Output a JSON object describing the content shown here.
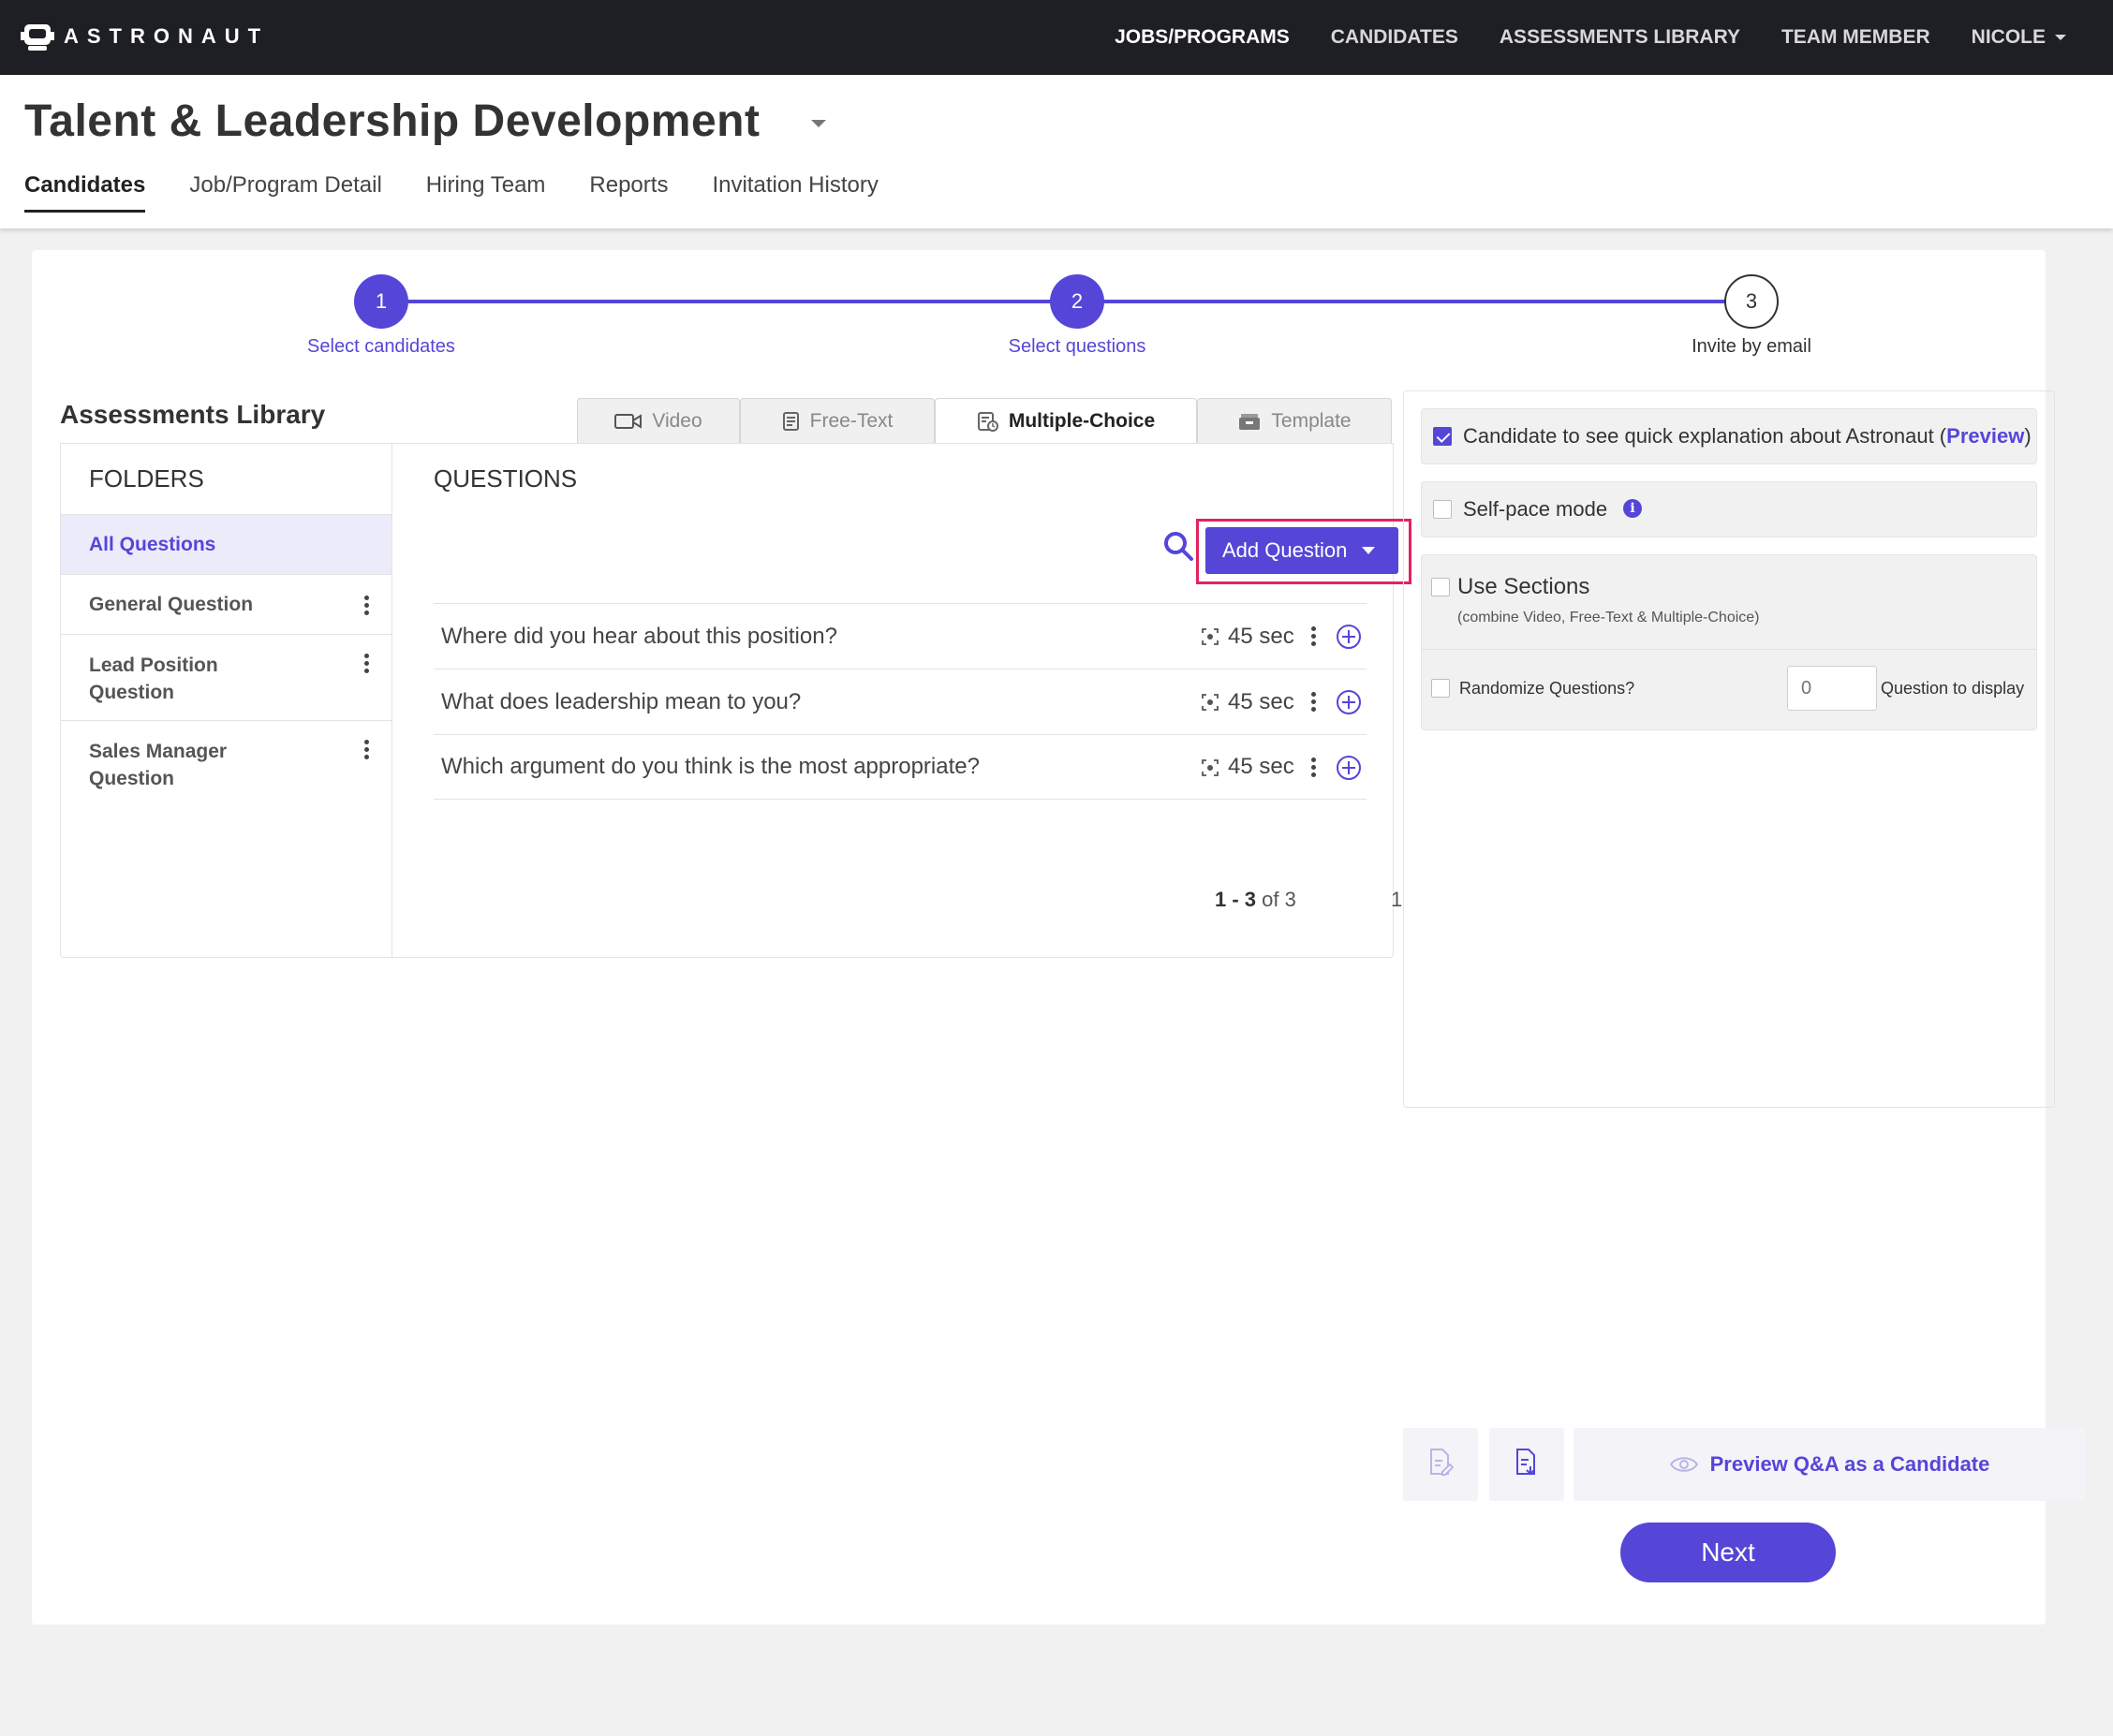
{
  "app": {
    "logo_text": "ASTRONAUT",
    "nav": [
      {
        "label": "JOBS/PROGRAMS",
        "active": true
      },
      {
        "label": "CANDIDATES"
      },
      {
        "label": "ASSESSMENTS LIBRARY"
      },
      {
        "label": "TEAM MEMBER"
      }
    ],
    "user_menu": "NICOLE"
  },
  "page": {
    "title": "Talent & Leadership Development",
    "subtabs": [
      "Candidates",
      "Job/Program Detail",
      "Hiring Team",
      "Reports",
      "Invitation History"
    ],
    "active_subtab": "Candidates"
  },
  "stepper": {
    "steps": [
      {
        "number": "1",
        "label": "Select candidates",
        "state": "done"
      },
      {
        "number": "2",
        "label": "Select questions",
        "state": "current"
      },
      {
        "number": "3",
        "label": "Invite by email",
        "state": "pending"
      }
    ]
  },
  "library": {
    "title": "Assessments Library",
    "tabs": [
      {
        "label": "Video",
        "icon": "video-camera-icon"
      },
      {
        "label": "Free-Text",
        "icon": "free-text-icon"
      },
      {
        "label": "Multiple-Choice",
        "icon": "multiple-choice-icon",
        "active": true
      },
      {
        "label": "Template",
        "icon": "template-icon"
      }
    ],
    "folders_heading": "FOLDERS",
    "folders": [
      {
        "label": "All Questions",
        "active": true
      },
      {
        "label": "General Question"
      },
      {
        "label": "Lead Position Question"
      },
      {
        "label": "Sales Manager Question"
      }
    ],
    "questions_heading": "QUESTIONS",
    "add_question_label": "Add Question",
    "questions": [
      {
        "text": "Where did you hear about this position?",
        "time": "45 sec"
      },
      {
        "text": "What does leadership mean to you?",
        "time": "45 sec"
      },
      {
        "text": "Which argument do you think is the most appropriate?",
        "time": "45 sec"
      }
    ],
    "pagination": {
      "range": "1 - 3",
      "of_text": "of 3",
      "page": "1"
    }
  },
  "settings": {
    "explanation": {
      "text": "Candidate to see quick explanation about Astronaut (",
      "link": "Preview",
      "close": ")",
      "checked": true
    },
    "self_pace": {
      "label": "Self-pace mode",
      "checked": false
    },
    "sections": {
      "label": "Use Sections",
      "note": "(combine Video, Free-Text & Multiple-Choice)",
      "checked": false
    },
    "randomize": {
      "label": "Randomize Questions?",
      "placeholder": "0",
      "suffix": "Question to display",
      "checked": false
    }
  },
  "actions": {
    "preview_label": "Preview Q&A as a Candidate",
    "next_label": "Next"
  },
  "colors": {
    "accent": "#5546d8",
    "topbar": "#1e1f24",
    "highlight": "#e0245e"
  }
}
